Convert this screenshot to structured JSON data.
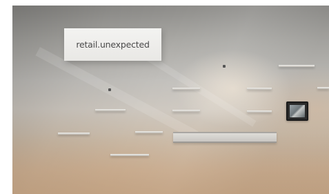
{
  "photo": {
    "sign_text": "retail.unexpected"
  }
}
